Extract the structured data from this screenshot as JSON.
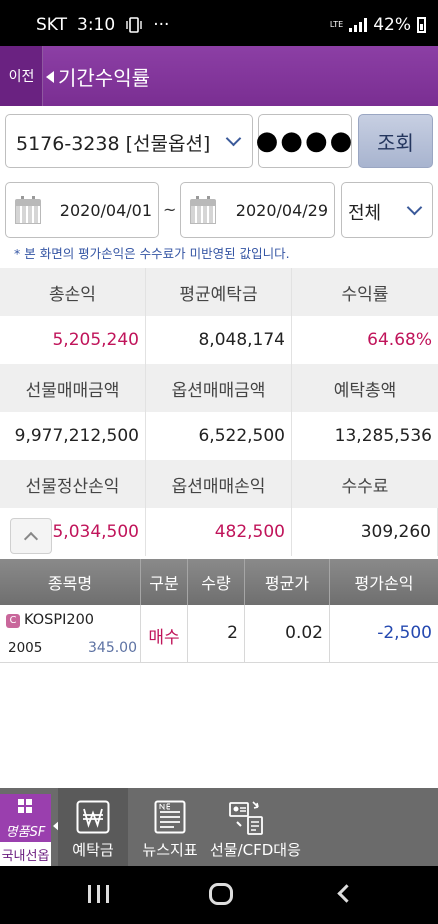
{
  "status": {
    "carrier": "SKT",
    "time": "3:10",
    "dots": "···",
    "battery": "42%",
    "lte": "LTE"
  },
  "header": {
    "back_label": "이전",
    "title": "기간수익률"
  },
  "account": {
    "number": "5176-3238 [선물옵션]",
    "password_mask": "●●●●",
    "query_label": "조회"
  },
  "period": {
    "start": "2020/04/01",
    "separator": "~",
    "end": "2020/04/29",
    "filter": "전체"
  },
  "note": "* 본 화면의 평가손익은 수수료가 미반영된 값입니다.",
  "summary": {
    "row1_headers": [
      "총손익",
      "평균예탁금",
      "수익률"
    ],
    "row1_values": [
      "5,205,240",
      "8,048,174",
      "64.68%"
    ],
    "row2_headers": [
      "선물매매금액",
      "옵션매매금액",
      "예탁총액"
    ],
    "row2_values": [
      "9,977,212,500",
      "6,522,500",
      "13,285,536"
    ],
    "row3_headers": [
      "선물정산손익",
      "옵션매매손익",
      "수수료"
    ],
    "row3_values": [
      "5,034,500",
      "482,500",
      "309,260"
    ]
  },
  "table": {
    "columns": [
      "종목명",
      "구분",
      "수량",
      "평균가",
      "평가손익"
    ],
    "rows": [
      {
        "badge": "C",
        "name": "KOSPI200",
        "code": "2005",
        "price": "345.00",
        "side": "매수",
        "qty": "2",
        "avg": "0.02",
        "pnl": "-2,500"
      }
    ]
  },
  "bottom_nav": {
    "brand_text": "명품SF",
    "brand_sub": "국내선옵",
    "items": [
      {
        "label": "예탁금",
        "icon": "won-icon"
      },
      {
        "label": "뉴스지표",
        "icon": "news-icon"
      },
      {
        "label": "선물/CFD대응",
        "icon": "cfd-icon"
      }
    ]
  },
  "colors": {
    "header_purple": "#8c3fa5",
    "profit_pink": "#c0145a",
    "loss_blue": "#2549b0",
    "note_blue": "#3455a4"
  }
}
